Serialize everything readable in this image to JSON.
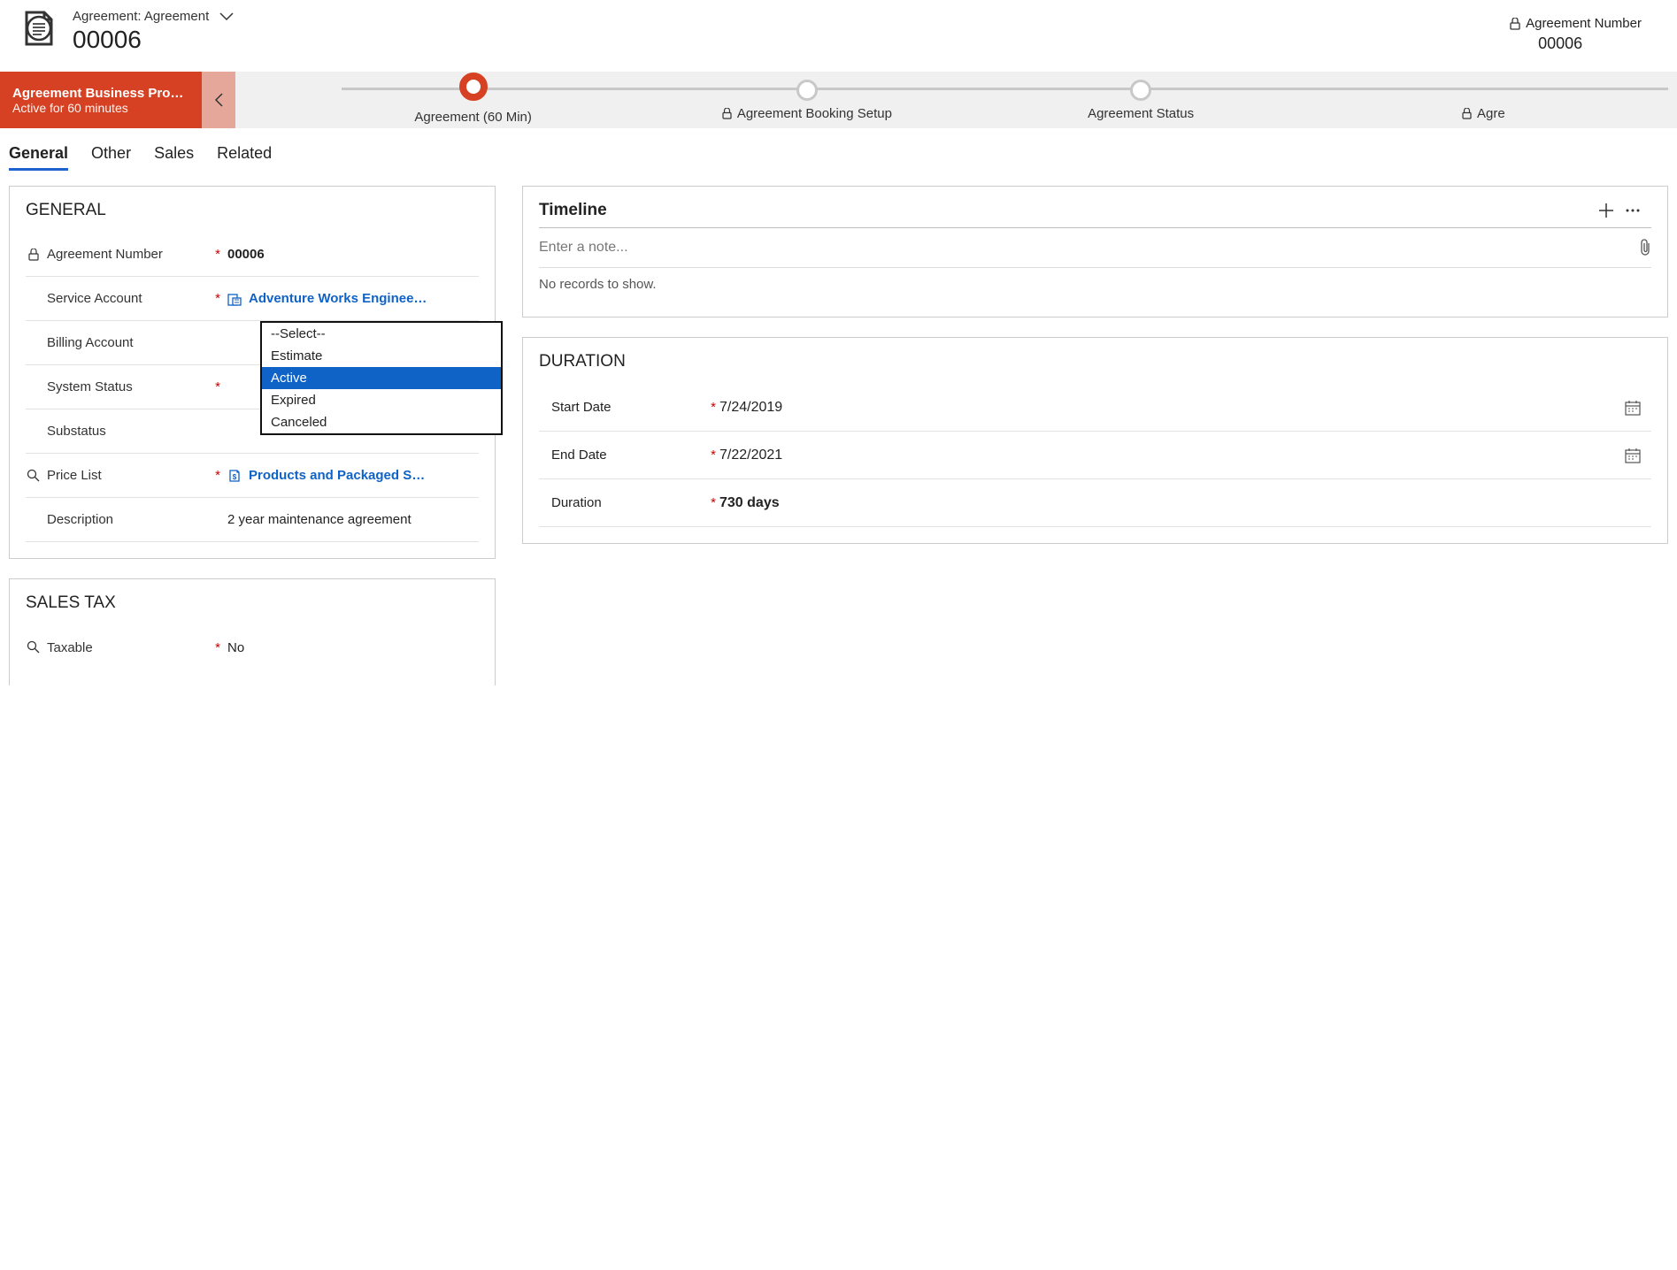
{
  "header": {
    "view_label": "Agreement: Agreement",
    "record_title": "00006",
    "right": {
      "label": "Agreement Number",
      "value": "00006"
    }
  },
  "bpf": {
    "name": "Agreement Business Pro…",
    "sub": "Active for 60 minutes",
    "stages": [
      {
        "label": "Agreement  (60 Min)",
        "active": true,
        "locked": false
      },
      {
        "label": "Agreement Booking Setup",
        "active": false,
        "locked": true
      },
      {
        "label": "Agreement Status",
        "active": false,
        "locked": false
      },
      {
        "label": "Agre",
        "active": false,
        "locked": true
      }
    ]
  },
  "tabs": [
    "General",
    "Other",
    "Sales",
    "Related"
  ],
  "general": {
    "section_title": "GENERAL",
    "fields": {
      "agreement_number": {
        "label": "Agreement Number",
        "value": "00006"
      },
      "service_account": {
        "label": "Service Account",
        "value": "Adventure Works Enginee…"
      },
      "billing_account": {
        "label": "Billing Account"
      },
      "system_status": {
        "label": "System Status",
        "options": [
          "--Select--",
          "Estimate",
          "Active",
          "Expired",
          "Canceled"
        ],
        "selected": "Active"
      },
      "substatus": {
        "label": "Substatus"
      },
      "price_list": {
        "label": "Price List",
        "value": "Products and Packaged S…"
      },
      "description": {
        "label": "Description",
        "value": "2 year maintenance agreement"
      }
    }
  },
  "sales_tax": {
    "section_title": "SALES TAX",
    "taxable": {
      "label": "Taxable",
      "value": "No"
    }
  },
  "timeline": {
    "title": "Timeline",
    "note_placeholder": "Enter a note...",
    "empty": "No records to show."
  },
  "duration": {
    "section_title": "DURATION",
    "start_date": {
      "label": "Start Date",
      "value": "7/24/2019"
    },
    "end_date": {
      "label": "End Date",
      "value": "7/22/2021"
    },
    "duration": {
      "label": "Duration",
      "value": "730 days"
    }
  }
}
